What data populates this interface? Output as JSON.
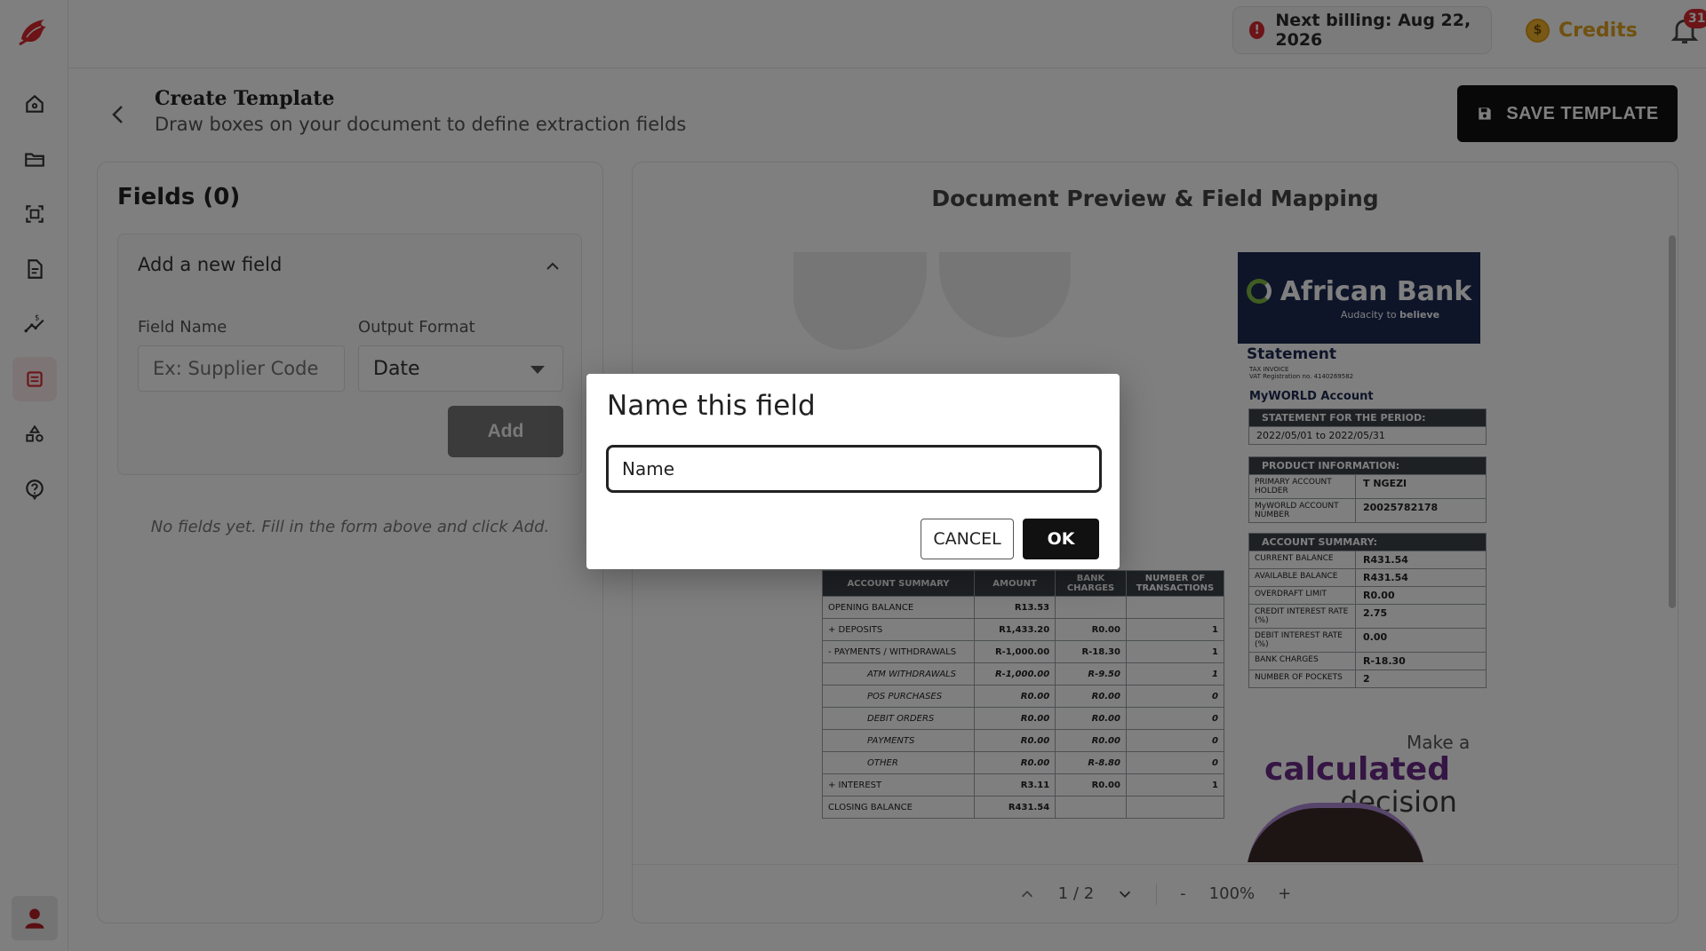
{
  "topbar": {
    "billing_text": "Next billing: Aug 22, 2026",
    "credits_label": "Credits",
    "notification_count": "31"
  },
  "header": {
    "title": "Create Template",
    "subtitle": "Draw boxes on your document to define extraction fields",
    "save_label": "SAVE TEMPLATE"
  },
  "sidebar": {
    "items": [
      "home-icon",
      "folder-icon",
      "scan-icon",
      "document-icon",
      "chart-icon",
      "template-icon",
      "shapes-icon",
      "help-icon"
    ],
    "active": "template-icon"
  },
  "fields_panel": {
    "title": "Fields (0)",
    "add_title": "Add a new field",
    "field_name_label": "Field Name",
    "field_name_placeholder": "Ex: Supplier Code",
    "output_format_label": "Output Format",
    "output_format_value": "Date",
    "add_button": "Add",
    "empty_message": "No fields yet. Fill in the form above and click Add."
  },
  "preview": {
    "title": "Document Preview & Field Mapping",
    "page_indicator": "1 / 2",
    "zoom": "100%",
    "zoom_out": "-",
    "zoom_in": "+"
  },
  "document": {
    "bank_name": "African Bank",
    "bank_tagline_1": "Audacity to",
    "bank_tagline_2": "believe",
    "statement": "Statement",
    "tax_line_1": "TAX INVOICE",
    "tax_line_2": "VAT Registration no. 4140269582",
    "account_type": "MyWORLD Account",
    "period_header": "STATEMENT FOR THE PERIOD:",
    "period_value": "2022/05/01 to 2022/05/31",
    "product_header": "PRODUCT INFORMATION:",
    "product_rows": [
      {
        "k": "PRIMARY ACCOUNT HOLDER",
        "v": "T NGEZI"
      },
      {
        "k": "MyWORLD ACCOUNT NUMBER",
        "v": "20025782178"
      }
    ],
    "summary_header": "ACCOUNT SUMMARY:",
    "summary_rows": [
      {
        "k": "CURRENT BALANCE",
        "v": "R431.54"
      },
      {
        "k": "AVAILABLE BALANCE",
        "v": "R431.54"
      },
      {
        "k": "OVERDRAFT LIMIT",
        "v": "R0.00"
      },
      {
        "k": "CREDIT INTEREST RATE (%)",
        "v": "2.75"
      },
      {
        "k": "DEBIT INTEREST RATE (%)",
        "v": "0.00"
      },
      {
        "k": "BANK CHARGES",
        "v": "R-18.30"
      },
      {
        "k": "NUMBER OF POCKETS",
        "v": "2"
      }
    ],
    "table_headers": [
      "ACCOUNT SUMMARY",
      "AMOUNT",
      "BANK CHARGES",
      "NUMBER OF TRANSACTIONS"
    ],
    "table_rows": [
      {
        "label": "OPENING BALANCE",
        "amount": "R13.53",
        "charges": "",
        "count": "",
        "italic": false
      },
      {
        "label": "+ DEPOSITS",
        "amount": "R1,433.20",
        "charges": "R0.00",
        "count": "1",
        "italic": false
      },
      {
        "label": "- PAYMENTS / WITHDRAWALS",
        "amount": "R-1,000.00",
        "charges": "R-18.30",
        "count": "1",
        "italic": false
      },
      {
        "label": "ATM WITHDRAWALS",
        "amount": "R-1,000.00",
        "charges": "R-9.50",
        "count": "1",
        "italic": true
      },
      {
        "label": "POS PURCHASES",
        "amount": "R0.00",
        "charges": "R0.00",
        "count": "0",
        "italic": true
      },
      {
        "label": "DEBIT ORDERS",
        "amount": "R0.00",
        "charges": "R0.00",
        "count": "0",
        "italic": true
      },
      {
        "label": "PAYMENTS",
        "amount": "R0.00",
        "charges": "R0.00",
        "count": "0",
        "italic": true
      },
      {
        "label": "OTHER",
        "amount": "R0.00",
        "charges": "R-8.80",
        "count": "0",
        "italic": true
      },
      {
        "label": "+ INTEREST",
        "amount": "R3.11",
        "charges": "R0.00",
        "count": "1",
        "italic": false
      },
      {
        "label": "CLOSING BALANCE",
        "amount": "R431.54",
        "charges": "",
        "count": "",
        "italic": false
      }
    ],
    "promo_line_1": "Make a",
    "promo_line_2": "calculated",
    "promo_line_3": "decision"
  },
  "dialog": {
    "title": "Name this field",
    "input_value": "Name",
    "cancel_label": "CANCEL",
    "ok_label": "OK"
  },
  "colors": {
    "brand_red": "#d8282f",
    "credits_gold": "#e0a21d",
    "bank_navy": "#1c2a52",
    "promo_purple": "#6a2b87"
  }
}
